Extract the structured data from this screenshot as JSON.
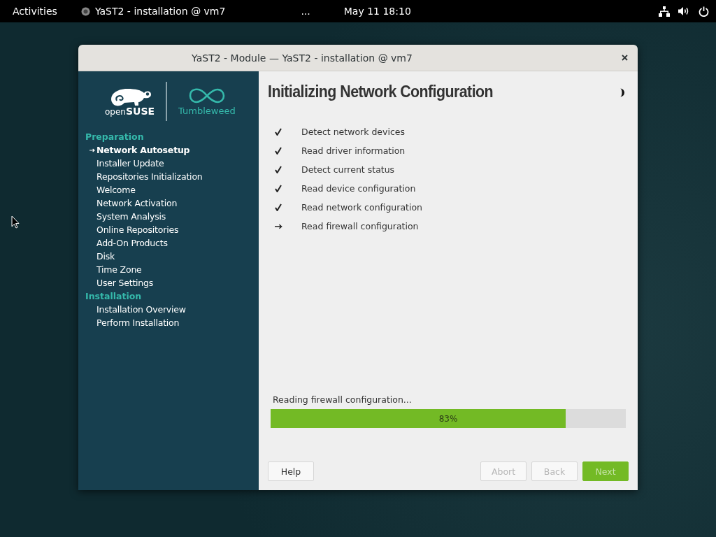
{
  "top_bar": {
    "activities": "Activities",
    "app": "YaST2 - installation @ vm7",
    "overflow": "...",
    "clock": "May 11  18:10"
  },
  "window": {
    "title": "YaST2 - Module — YaST2 - installation @ vm7"
  },
  "logo": {
    "brand": "open**SUSE**",
    "edition": "Tumbleweed"
  },
  "sidebar": {
    "sections": [
      {
        "title": "Preparation",
        "items": [
          {
            "label": "Network Autosetup",
            "selected": true
          },
          {
            "label": "Installer Update",
            "selected": false
          },
          {
            "label": "Repositories Initialization",
            "selected": false
          },
          {
            "label": "Welcome",
            "selected": false
          },
          {
            "label": "Network Activation",
            "selected": false
          },
          {
            "label": "System Analysis",
            "selected": false
          },
          {
            "label": "Online Repositories",
            "selected": false
          },
          {
            "label": "Add-On Products",
            "selected": false
          },
          {
            "label": "Disk",
            "selected": false
          },
          {
            "label": "Time Zone",
            "selected": false
          },
          {
            "label": "User Settings",
            "selected": false
          }
        ]
      },
      {
        "title": "Installation",
        "items": [
          {
            "label": "Installation Overview",
            "selected": false
          },
          {
            "label": "Perform Installation",
            "selected": false
          }
        ]
      }
    ]
  },
  "main": {
    "heading": "Initializing Network Configuration",
    "steps": [
      {
        "label": "Detect network devices",
        "done": true
      },
      {
        "label": "Read driver information",
        "done": true
      },
      {
        "label": "Detect current status",
        "done": true
      },
      {
        "label": "Read device configuration",
        "done": true
      },
      {
        "label": "Read network configuration",
        "done": true
      },
      {
        "label": "Read firewall configuration",
        "done": false
      }
    ],
    "progress": {
      "label": "Reading firewall configuration...",
      "level": 0.83,
      "text": "83%"
    }
  },
  "buttons": [
    {
      "label": "Help",
      "kind": "normal",
      "disabled": false
    },
    {
      "label": "Abort",
      "kind": "normal",
      "disabled": true
    },
    {
      "label": "Back",
      "kind": "normal",
      "disabled": true
    },
    {
      "label": "Next",
      "kind": "primary",
      "disabled": true
    }
  ]
}
